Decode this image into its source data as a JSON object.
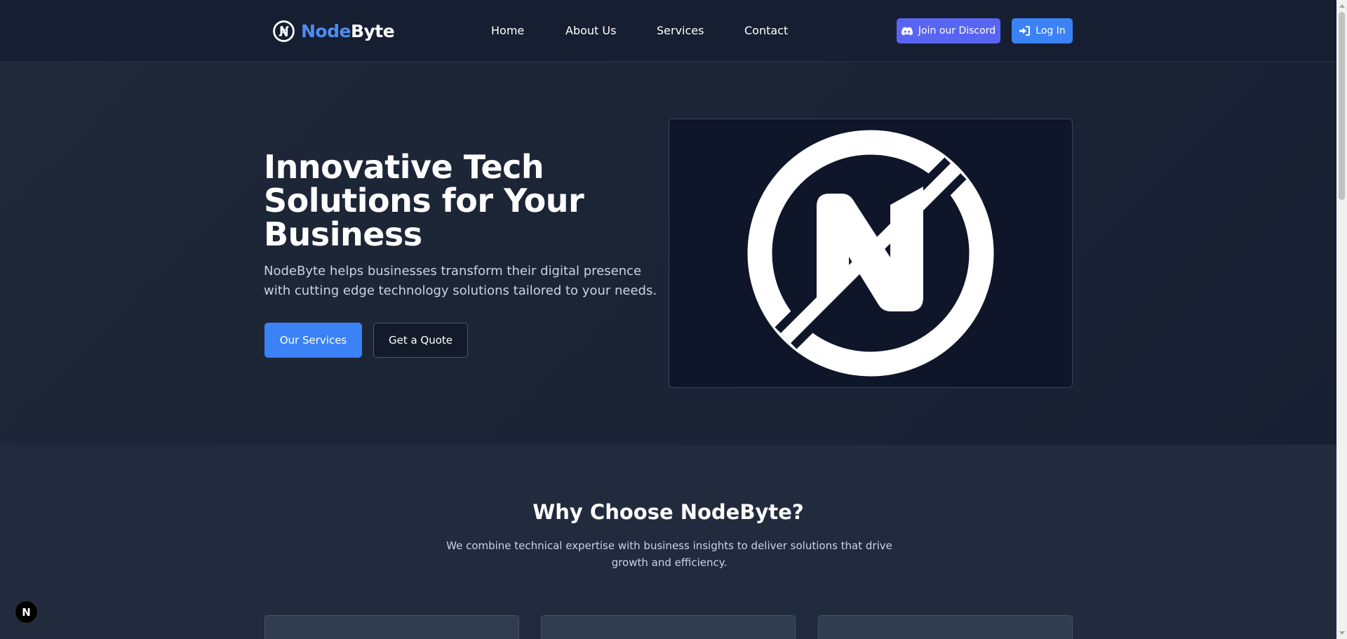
{
  "brand": {
    "name_part1": "Node",
    "name_part2": "Byte",
    "accent": "#4e8cf2",
    "icon": "nodebyte-logo-icon"
  },
  "nav": {
    "items": [
      {
        "label": "Home"
      },
      {
        "label": "About Us"
      },
      {
        "label": "Services"
      },
      {
        "label": "Contact"
      }
    ]
  },
  "header_actions": {
    "discord_label": "Join our Discord",
    "discord_icon": "discord-icon",
    "discord_color": "#5865f2",
    "login_label": "Log In",
    "login_icon": "login-icon",
    "login_color": "#3b82f6"
  },
  "hero": {
    "title": "Innovative Tech Solutions for Your Business",
    "subtitle": "NodeByte helps businesses transform their digital presence with cutting edge technology solutions tailored to your needs.",
    "primary_button": "Our Services",
    "secondary_button": "Get a Quote"
  },
  "why": {
    "title": "Why Choose NodeByte?",
    "subtitle": "We combine technical expertise with business insights to deliver solutions that drive growth and efficiency."
  },
  "dev_badge": {
    "label": "N"
  }
}
